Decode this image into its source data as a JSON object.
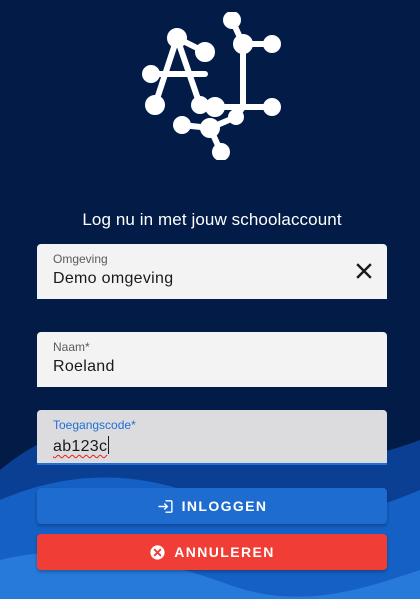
{
  "colors": {
    "background": "#031c47",
    "primary": "#1e6ccf",
    "danger": "#f03e37",
    "field_background": "#f3f3f4"
  },
  "logo": {
    "icon": "ai-circuit-logo-icon"
  },
  "subtitle": "Log nu in met jouw schoolaccount",
  "form": {
    "environment": {
      "label": "Omgeving",
      "value": "Demo omgeving",
      "clear_icon": "close-icon"
    },
    "name": {
      "label": "Naam*",
      "value": "Roeland"
    },
    "access_code": {
      "label": "Toegangscode*",
      "value": "ab123c"
    }
  },
  "buttons": {
    "login": {
      "label": "INLOGGEN",
      "icon": "login-icon"
    },
    "cancel": {
      "label": "ANNULEREN",
      "icon": "cancel-circle-icon"
    }
  }
}
